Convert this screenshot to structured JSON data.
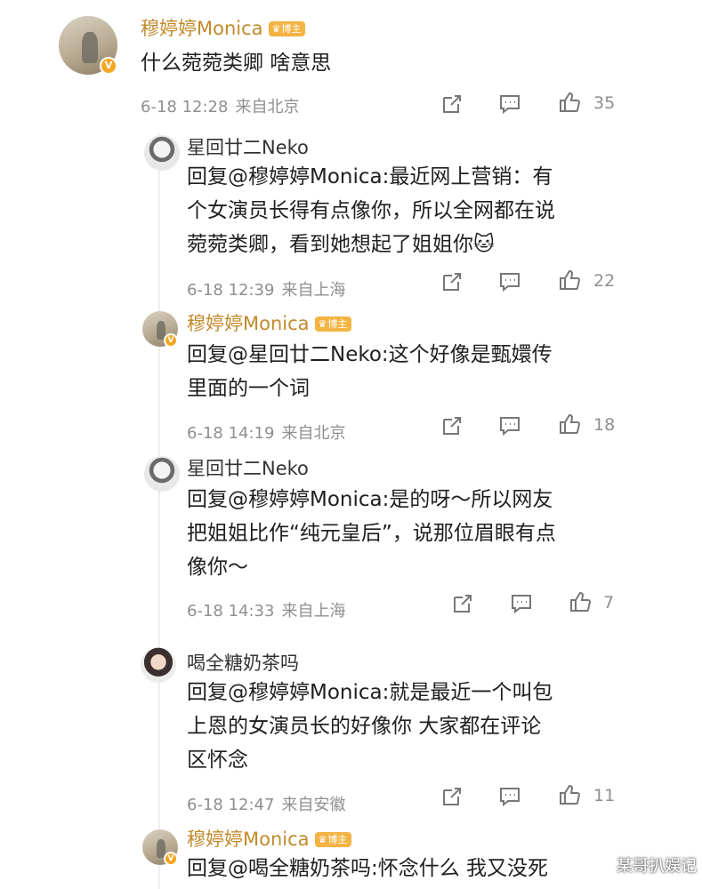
{
  "comments": [
    {
      "user": "穆婷婷Monica",
      "badge": "博主",
      "text": "什么菀菀类卿 啥意思",
      "date": "6-18 12:28",
      "location": "来自北京",
      "likes": "35"
    },
    {
      "user": "星回廿二Neko",
      "text": "回复@穆婷婷Monica:最近网上营销：有个女演员长得有点像你，所以全网都在说菀菀类卿，看到她想起了姐姐你🐱",
      "date": "6-18 12:39",
      "location": "来自上海",
      "likes": "22"
    },
    {
      "user": "穆婷婷Monica",
      "badge": "博主",
      "text": "回复@星回廿二Neko:这个好像是甄嬛传里面的一个词",
      "date": "6-18 14:19",
      "location": "来自北京",
      "likes": "18"
    },
    {
      "user": "星回廿二Neko",
      "text": "回复@穆婷婷Monica:是的呀～所以网友把姐姐比作“纯元皇后”，说那位眉眼有点像你～",
      "date": "6-18 14:33",
      "location": "来自上海",
      "likes": "7"
    },
    {
      "user": "喝全糖奶茶吗",
      "text": "回复@穆婷婷Monica:就是最近一个叫包上恩的女演员长的好像你  大家都在评论区怀念",
      "date": "6-18 12:47",
      "location": "来自安徽",
      "likes": "11"
    },
    {
      "user": "穆婷婷Monica",
      "badge": "博主",
      "text": "回复@喝全糖奶茶吗:怀念什么 我又没死"
    }
  ],
  "lines": {
    "c1": [
      "什么菀菀类卿 啥意思"
    ],
    "c2": [
      "回复@穆婷婷Monica:最近网上营销：有",
      "个女演员长得有点像你，所以全网都在说",
      "菀菀类卿，看到她想起了姐姐你🐱"
    ],
    "c3": [
      "回复@星回廿二Neko:这个好像是甄嬛传",
      "里面的一个词"
    ],
    "c4": [
      "回复@穆婷婷Monica:是的呀～所以网友",
      "把姐姐比作“纯元皇后”，说那位眉眼有点",
      "像你～"
    ],
    "c5": [
      "回复@穆婷婷Monica:就是最近一个叫包",
      "上恩的女演员长的好像你  大家都在评论",
      "区怀念"
    ],
    "c6": [
      "回复@喝全糖奶茶吗:怀念什么 我又没死"
    ]
  },
  "watermark": "某哥扒娱记",
  "colors": {
    "username_vip": "#c28a2b",
    "badge_bg": "#f3b443",
    "meta": "#8f8f8f"
  },
  "icons": {
    "share": "share-icon",
    "comment": "comment-icon",
    "like": "like-icon"
  }
}
